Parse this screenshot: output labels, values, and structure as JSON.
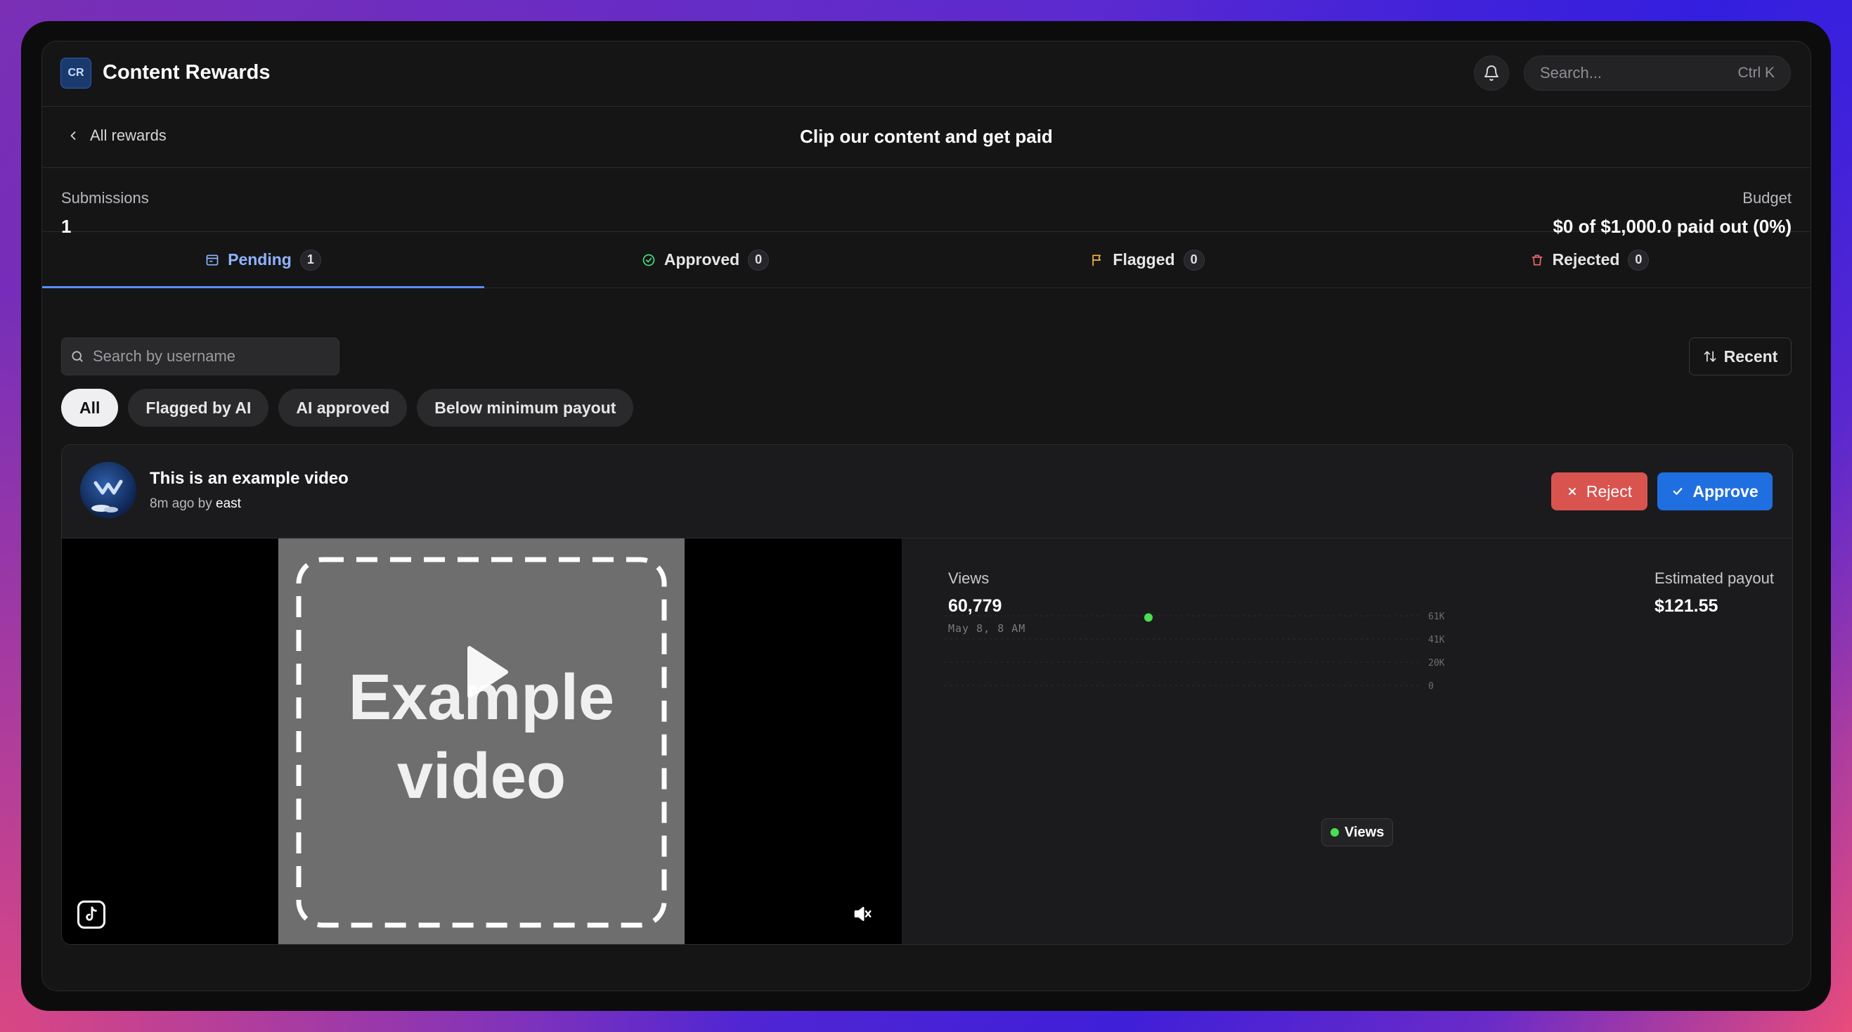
{
  "app": {
    "logo": "CR",
    "title": "Content Rewards"
  },
  "header": {
    "search_placeholder": "Search...",
    "search_shortcut": "Ctrl K",
    "bell_icon": "bell-icon"
  },
  "nav": {
    "back_label": "All rewards",
    "page_title": "Clip our content and get paid"
  },
  "stats": {
    "submissions_label": "Submissions",
    "submissions_value": "1",
    "budget_label": "Budget",
    "budget_value": "$0 of $1,000.0 paid out (0%)"
  },
  "tabs": [
    {
      "label": "Pending",
      "count": "1",
      "icon": "inbox-icon",
      "active": true
    },
    {
      "label": "Approved",
      "count": "0",
      "icon": "check-circle-icon"
    },
    {
      "label": "Flagged",
      "count": "0",
      "icon": "flag-icon"
    },
    {
      "label": "Rejected",
      "count": "0",
      "icon": "trash-icon"
    }
  ],
  "filters": {
    "search_placeholder": "Search by username",
    "sort_label": "Recent",
    "chips": [
      "All",
      "Flagged by AI",
      "AI approved",
      "Below minimum payout"
    ]
  },
  "submission": {
    "title": "This is an example video",
    "time_ago": "8m ago by",
    "author": "east",
    "reject_label": "Reject",
    "approve_label": "Approve",
    "video_text_1": "Example",
    "video_text_2": "video",
    "platform_icon": "tiktok-icon",
    "mute_icon": "muted-speaker-icon"
  },
  "metrics": {
    "views_label": "Views",
    "views_value": "60,779",
    "views_date": "May 8, 8 AM",
    "payout_label": "Estimated payout",
    "payout_value": "$121.55"
  },
  "chart_data": {
    "type": "scatter",
    "series": [
      {
        "name": "Views",
        "points": [
          {
            "x": "May 8, 8 AM",
            "y": 60779
          }
        ],
        "color": "#4ade50"
      }
    ],
    "y_ticks": [
      "61K",
      "41K",
      "20K",
      "0"
    ],
    "ylim": [
      0,
      61000
    ],
    "legend": "bottom-center",
    "grid": true
  }
}
